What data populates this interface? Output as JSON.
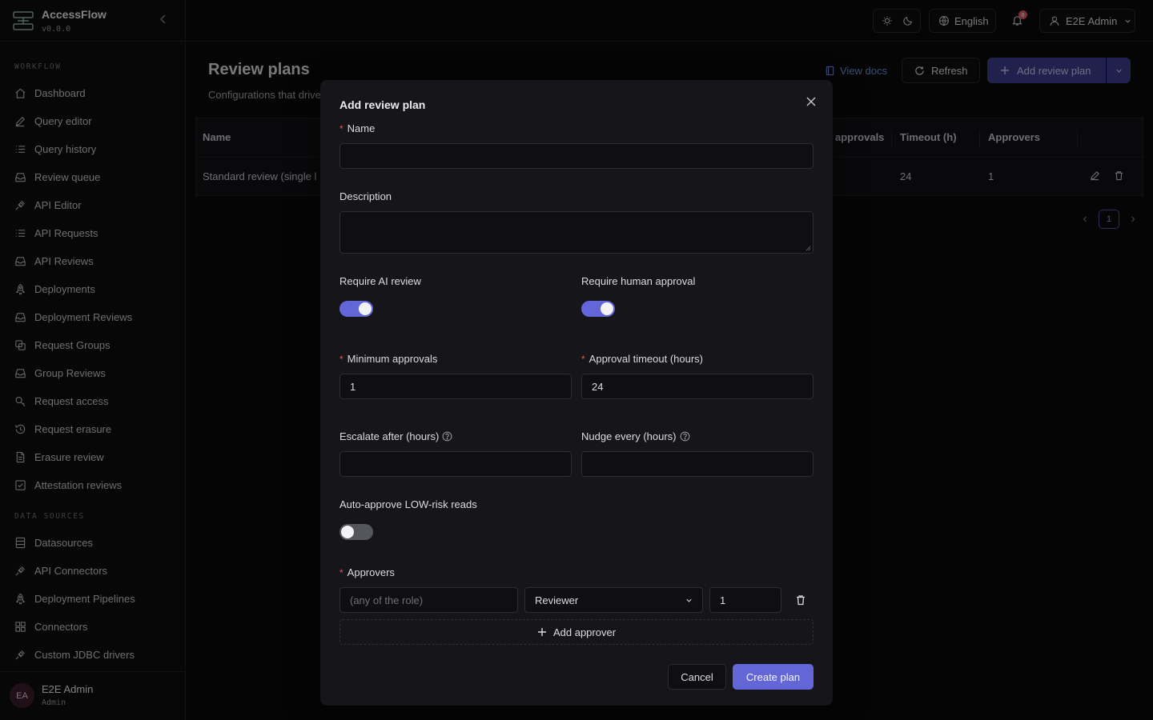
{
  "app": {
    "name": "AccessFlow",
    "version": "v0.0.0"
  },
  "sidebar": {
    "sections": [
      {
        "title": "WORKFLOW",
        "items": [
          {
            "label": "Dashboard",
            "icon": "home-icon"
          },
          {
            "label": "Query editor",
            "icon": "pencil-icon"
          },
          {
            "label": "Query history",
            "icon": "list-icon"
          },
          {
            "label": "Review queue",
            "icon": "inbox-icon"
          },
          {
            "label": "API Editor",
            "icon": "plug-icon"
          },
          {
            "label": "API Requests",
            "icon": "list-icon"
          },
          {
            "label": "API Reviews",
            "icon": "inbox-icon"
          },
          {
            "label": "Deployments",
            "icon": "rocket-icon"
          },
          {
            "label": "Deployment Reviews",
            "icon": "inbox-icon"
          },
          {
            "label": "Request Groups",
            "icon": "layers-icon"
          },
          {
            "label": "Group Reviews",
            "icon": "inbox-icon"
          },
          {
            "label": "Request access",
            "icon": "key-icon"
          },
          {
            "label": "Request erasure",
            "icon": "history-icon"
          },
          {
            "label": "Erasure review",
            "icon": "file-icon"
          },
          {
            "label": "Attestation reviews",
            "icon": "check-square-icon"
          }
        ]
      },
      {
        "title": "DATA SOURCES",
        "items": [
          {
            "label": "Datasources",
            "icon": "database-icon"
          },
          {
            "label": "API Connectors",
            "icon": "plug-icon"
          },
          {
            "label": "Deployment Pipelines",
            "icon": "rocket-icon"
          },
          {
            "label": "Connectors",
            "icon": "grid-icon"
          },
          {
            "label": "Custom JDBC drivers",
            "icon": "plug-icon"
          }
        ]
      }
    ],
    "user": {
      "initials": "EA",
      "name": "E2E Admin",
      "role": "Admin"
    }
  },
  "topbar": {
    "language": "English",
    "notifications": "8",
    "user": "E2E Admin"
  },
  "page": {
    "title": "Review plans",
    "subtitle": "Configurations that drive",
    "view_docs": "View docs",
    "refresh": "Refresh",
    "add_plan": "Add review plan"
  },
  "table": {
    "headers": {
      "name": "Name",
      "approvals": "approvals",
      "timeout": "Timeout (h)",
      "approvers": "Approvers"
    },
    "row": {
      "name": "Standard review (single l",
      "timeout": "24",
      "approvers": "1"
    },
    "page": "1"
  },
  "modal": {
    "title": "Add review plan",
    "name_label": "Name",
    "description_label": "Description",
    "ai_review_label": "Require AI review",
    "human_approval_label": "Require human approval",
    "min_approvals_label": "Minimum approvals",
    "min_approvals_value": "1",
    "timeout_label": "Approval timeout (hours)",
    "timeout_value": "24",
    "escalate_label": "Escalate after (hours)",
    "nudge_label": "Nudge every (hours)",
    "auto_approve_label": "Auto-approve LOW-risk reads",
    "approvers_label": "Approvers",
    "approver_placeholder": "(any of the role)",
    "approver_role": "Reviewer",
    "approver_count": "1",
    "add_approver": "Add approver",
    "cancel": "Cancel",
    "create": "Create plan",
    "toggles": {
      "ai_review": true,
      "human_approval": true,
      "auto_approve": false
    }
  },
  "colors": {
    "accent": "#6366d6",
    "danger": "#e0565b",
    "background": "#0a0a0b"
  }
}
